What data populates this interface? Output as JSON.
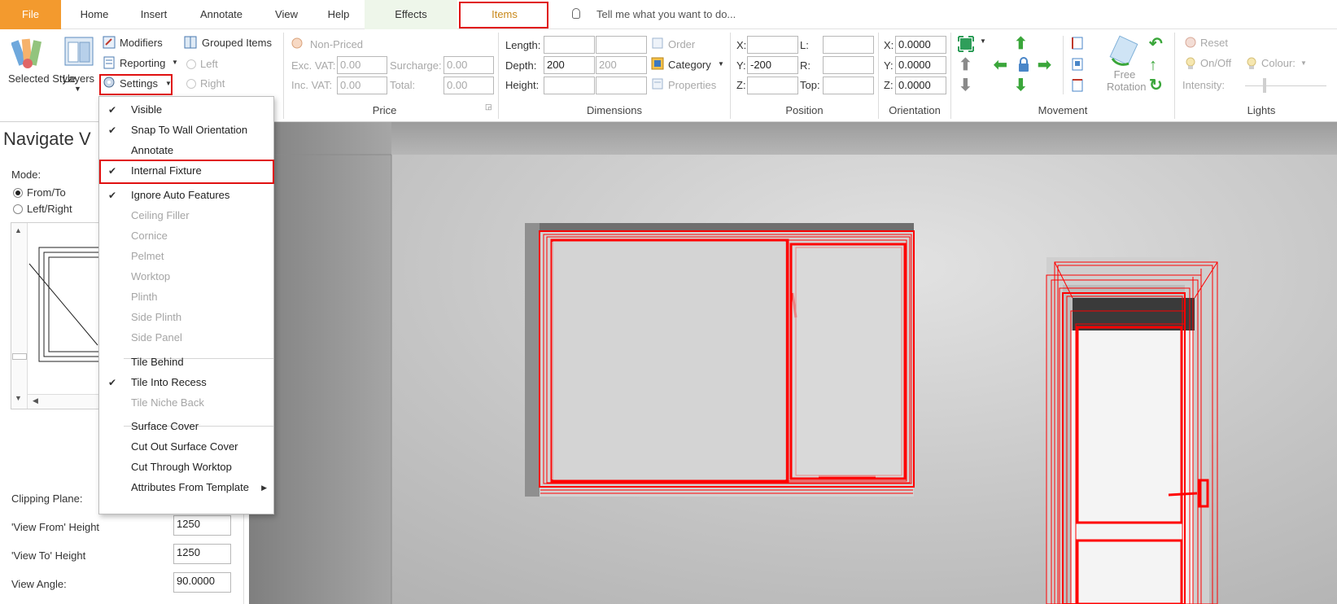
{
  "menubar": {
    "tabs": [
      "File",
      "Home",
      "Insert",
      "Annotate",
      "View",
      "Help",
      "Effects",
      "Items"
    ],
    "tell_me": "Tell me what you want to do..."
  },
  "ribbon": {
    "selected_style": "Selected Style",
    "layers": "Layers",
    "modifiers": "Modifiers",
    "reporting": "Reporting",
    "settings": "Settings",
    "grouped_items": "Grouped Items",
    "left": "Left",
    "right": "Right",
    "price": {
      "label": "Price",
      "non_priced": "Non-Priced",
      "exc_vat_label": "Exc. VAT:",
      "exc_vat": "0.00",
      "surcharge_label": "Surcharge:",
      "surcharge": "0.00",
      "inc_vat_label": "Inc. VAT:",
      "inc_vat": "0.00",
      "total_label": "Total:",
      "total": "0.00"
    },
    "dimensions": {
      "label": "Dimensions",
      "length_label": "Length:",
      "depth_label": "Depth:",
      "depth": "200",
      "depth2": "200",
      "height_label": "Height:",
      "order": "Order",
      "category": "Category",
      "properties": "Properties"
    },
    "position": {
      "label": "Position",
      "x_label": "X:",
      "y_label": "Y:",
      "y": "-200",
      "z_label": "Z:",
      "l_label": "L:",
      "r_label": "R:",
      "top_label": "Top:"
    },
    "orientation": {
      "label": "Orientation",
      "x_label": "X:",
      "x": "0.0000",
      "y_label": "Y:",
      "y": "0.0000",
      "z_label": "Z:",
      "z": "0.0000"
    },
    "movement": {
      "label": "Movement",
      "free_rotation": "Free Rotation"
    },
    "lights": {
      "label": "Lights",
      "reset": "Reset",
      "on_off": "On/Off",
      "colour": "Colour:",
      "intensity": "Intensity:"
    }
  },
  "left_panel": {
    "title": "Navigate V",
    "mode_label": "Mode:",
    "from_to": "From/To",
    "left_right": "Left/Right",
    "clipping_plane": "Clipping Plane:",
    "view_from_height_label": "'View From' Height",
    "view_from_height": "1250",
    "view_to_height_label": "'View To' Height",
    "view_to_height": "1250",
    "view_angle_label": "View Angle:",
    "view_angle": "90.0000"
  },
  "settings_menu": {
    "items": [
      {
        "label": "Visible",
        "checked": true,
        "disabled": false
      },
      {
        "label": "Snap To Wall Orientation",
        "checked": true,
        "disabled": false
      },
      {
        "label": "Annotate",
        "checked": false,
        "disabled": false
      },
      {
        "label": "Internal Fixture",
        "checked": true,
        "disabled": false
      },
      {
        "label": "Ignore Auto Features",
        "checked": true,
        "disabled": false
      },
      {
        "label": "Ceiling Filler",
        "checked": false,
        "disabled": true
      },
      {
        "label": "Cornice",
        "checked": false,
        "disabled": true
      },
      {
        "label": "Pelmet",
        "checked": false,
        "disabled": true
      },
      {
        "label": "Worktop",
        "checked": false,
        "disabled": true
      },
      {
        "label": "Plinth",
        "checked": false,
        "disabled": true
      },
      {
        "label": "Side Plinth",
        "checked": false,
        "disabled": true
      },
      {
        "label": "Side Panel",
        "checked": false,
        "disabled": true
      },
      {
        "label": "Tile Behind",
        "checked": false,
        "disabled": false
      },
      {
        "label": "Tile Into Recess",
        "checked": true,
        "disabled": false
      },
      {
        "label": "Tile Niche Back",
        "checked": false,
        "disabled": true
      },
      {
        "label": "Surface Cover",
        "checked": false,
        "disabled": false
      },
      {
        "label": "Cut Out Surface Cover",
        "checked": false,
        "disabled": false
      },
      {
        "label": "Cut Through Worktop",
        "checked": false,
        "disabled": false
      },
      {
        "label": "Attributes From Template",
        "checked": false,
        "disabled": false,
        "submenu": true
      }
    ]
  },
  "colors": {
    "file_tab": "#f39a2e",
    "highlight": "#e01010",
    "model_lines": "#ff0000"
  }
}
